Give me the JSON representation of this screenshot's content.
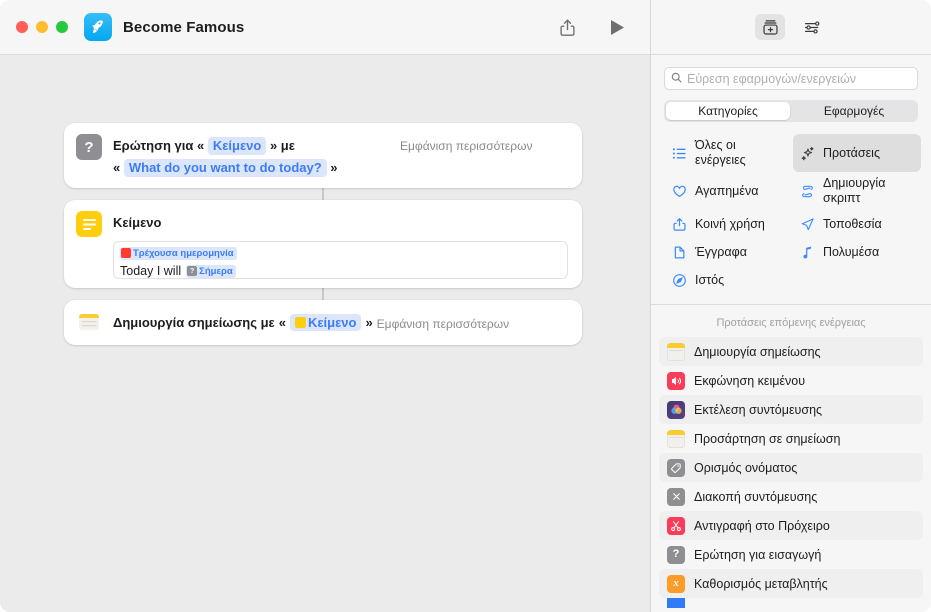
{
  "window": {
    "app_title": "Become Famous",
    "app_icon": "rocket-icon",
    "traffic_lights": [
      "close",
      "minimize",
      "zoom"
    ],
    "toolbar": {
      "share_label": "share-icon",
      "play_label": "play-icon"
    }
  },
  "workflow": {
    "cards": [
      {
        "id": "ask-for-text",
        "icon": "question-mark-icon",
        "prefix": "Ερώτηση για",
        "open_quote": "«",
        "token1": "Κείμενο",
        "close_quote": "»",
        "mid": "με",
        "line2_open": "«",
        "token2": "What do you want to do today?",
        "line2_close": "»",
        "show_more": "Εμφάνιση περισσότερων"
      },
      {
        "id": "text",
        "icon": "text-lines-icon",
        "title": "Κείμενο",
        "field": {
          "chip_label": "Τρέχουσα ημερομηνία",
          "chip_icon": "calendar-icon",
          "body_text": "Today I will",
          "inline_chip_label": "Σήμερα",
          "inline_chip_icon": "question-mark-icon"
        }
      },
      {
        "id": "create-note",
        "icon": "note-icon",
        "prefix": "Δημιουργία σημείωσης με",
        "open_quote": "«",
        "token": "Κείμενο",
        "token_icon": "text-lines-icon",
        "close_quote": "»",
        "show_more": "Εμφάνιση περισσότερων"
      }
    ]
  },
  "inspector": {
    "toolbar": [
      {
        "name": "action-library-icon",
        "selected": true
      },
      {
        "name": "sliders-icon",
        "selected": false
      }
    ],
    "search": {
      "placeholder": "Εύρεση εφαρμογών/ενεργειών",
      "value": "",
      "icon": "search-icon"
    },
    "segmented": {
      "options": [
        "Κατηγορίες",
        "Εφαρμογές"
      ],
      "selected": "Κατηγορίες"
    },
    "categories": [
      {
        "label": "Όλες οι ενέργειες",
        "icon": "list-bullet-icon",
        "selected": false
      },
      {
        "label": "Προτάσεις",
        "icon": "sparkles-icon",
        "selected": true
      },
      {
        "label": "Αγαπημένα",
        "icon": "heart-icon",
        "selected": false
      },
      {
        "label": "Δημιουργία σκριπτ",
        "icon": "scroll-icon",
        "selected": false
      },
      {
        "label": "Κοινή χρήση",
        "icon": "share-icon",
        "selected": false
      },
      {
        "label": "Τοποθεσία",
        "icon": "location-arrow-icon",
        "selected": false
      },
      {
        "label": "Έγγραφα",
        "icon": "document-icon",
        "selected": false
      },
      {
        "label": "Πολυμέσα",
        "icon": "music-note-icon",
        "selected": false
      },
      {
        "label": "Ιστός",
        "icon": "safari-compass-icon",
        "selected": false
      }
    ],
    "suggestions_header": "Προτάσεις επόμενης ενέργειας",
    "suggestions": [
      {
        "label": "Δημιουργία σημείωσης",
        "icon": "note-icon",
        "icon_style": "note"
      },
      {
        "label": "Εκφώνηση κειμένου",
        "icon": "speaker-icon",
        "icon_style": "red"
      },
      {
        "label": "Εκτέλεση συντόμευσης",
        "icon": "shortcuts-icon",
        "icon_style": "shortcut"
      },
      {
        "label": "Προσάρτηση σε σημείωση",
        "icon": "note-icon",
        "icon_style": "note"
      },
      {
        "label": "Ορισμός ονόματος",
        "icon": "tag-icon",
        "icon_style": "gray"
      },
      {
        "label": "Διακοπή συντόμευσης",
        "icon": "x-mark-icon",
        "icon_style": "gray"
      },
      {
        "label": "Αντιγραφή στο Πρόχειρο",
        "icon": "scissors-icon",
        "icon_style": "red"
      },
      {
        "label": "Ερώτηση για εισαγωγή",
        "icon": "question-mark-icon",
        "icon_style": "gray"
      },
      {
        "label": "Καθορισμός μεταβλητής",
        "icon": "variable-x-icon",
        "icon_style": "orange"
      }
    ]
  },
  "colors": {
    "accent_blue": "#3d7cf4",
    "token_bg": "#dce6fb",
    "yellow": "#ffcf0f",
    "red": "#fa3c5a",
    "gray": "#8e8e93",
    "orange": "#fb9b28",
    "canvas_bg": "#ebebeb",
    "panel_bg": "#f6f6f6"
  }
}
